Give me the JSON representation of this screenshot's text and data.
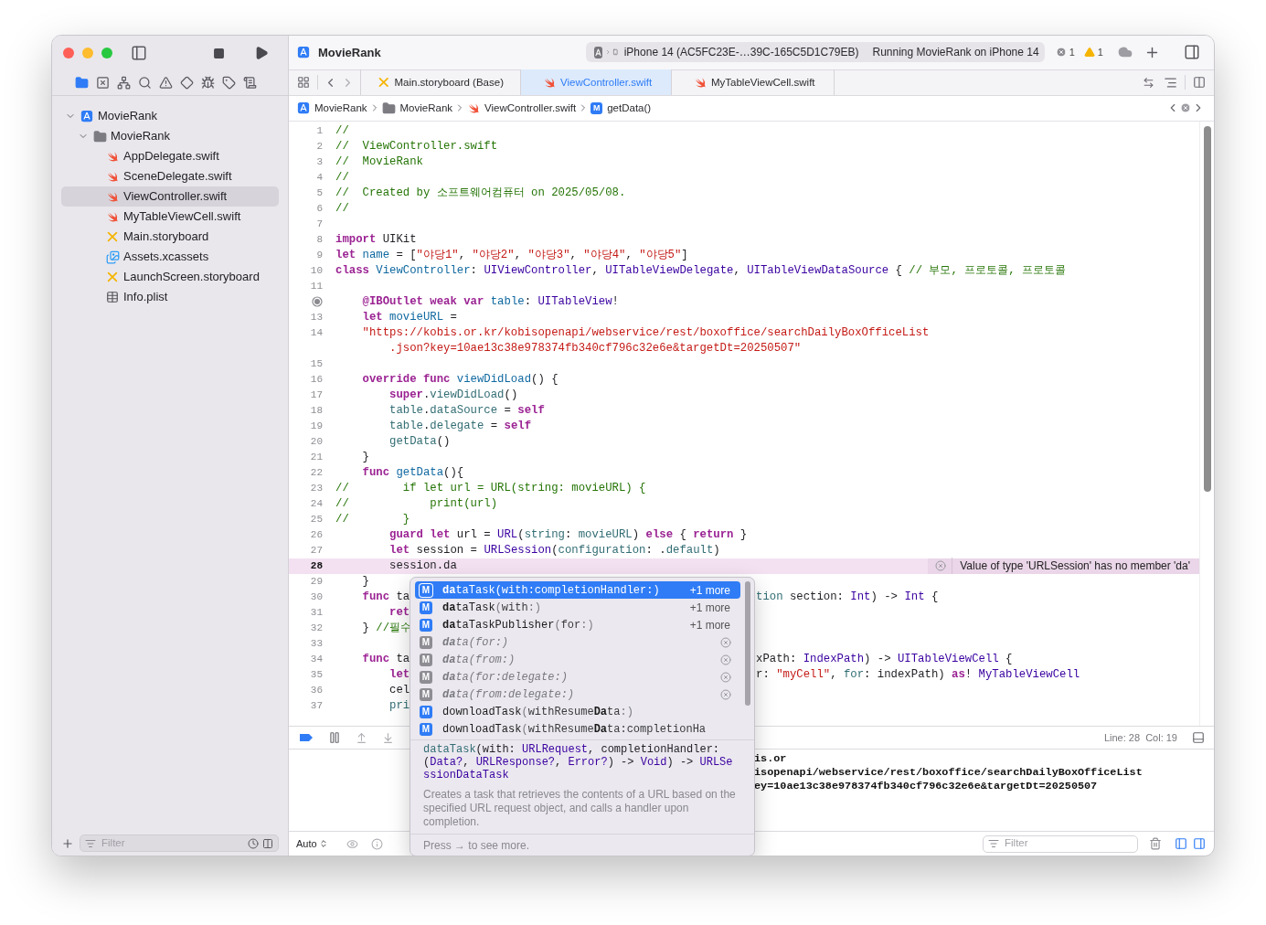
{
  "toolbar": {
    "title": "MovieRank",
    "device": "iPhone 14 (AC5FC23E-…39C-165C5D1C79EB)",
    "status": "Running MovieRank on iPhone 14",
    "errors": "1",
    "warnings": "1"
  },
  "sidebar": {
    "nav_tabs": [
      {
        "selected": true
      },
      {
        "selected": false
      },
      {
        "selected": false
      },
      {
        "selected": false
      },
      {
        "selected": false
      },
      {
        "selected": false
      },
      {
        "selected": false
      },
      {
        "selected": false
      },
      {
        "selected": false
      }
    ],
    "tree": [
      {
        "label": "MovieRank",
        "kind": "project",
        "expanded": true,
        "selected": false,
        "children": [
          {
            "label": "MovieRank",
            "kind": "folder",
            "expanded": true,
            "selected": false,
            "children": [
              {
                "label": "AppDelegate.swift",
                "kind": "swift",
                "selected": false
              },
              {
                "label": "SceneDelegate.swift",
                "kind": "swift",
                "selected": false
              },
              {
                "label": "ViewController.swift",
                "kind": "swift",
                "selected": true
              },
              {
                "label": "MyTableViewCell.swift",
                "kind": "swift",
                "selected": false
              },
              {
                "label": "Main.storyboard",
                "kind": "storyboard",
                "selected": false
              },
              {
                "label": "Assets.xcassets",
                "kind": "assets",
                "selected": false
              },
              {
                "label": "LaunchScreen.storyboard",
                "kind": "storyboard",
                "selected": false
              },
              {
                "label": "Info.plist",
                "kind": "plist",
                "selected": false
              }
            ]
          }
        ]
      }
    ],
    "filter": {
      "placeholder": "Filter"
    }
  },
  "editor": {
    "tabs": [
      {
        "label": "Main.storyboard (Base)",
        "kind": "storyboard",
        "selected": false
      },
      {
        "label": "ViewController.swift",
        "kind": "swift",
        "selected": true
      },
      {
        "label": "MyTableViewCell.swift",
        "kind": "swift",
        "selected": false
      }
    ],
    "breadcrumb": [
      {
        "label": "MovieRank",
        "kind": "project"
      },
      {
        "label": "MovieRank",
        "kind": "folder"
      },
      {
        "label": "ViewController.swift",
        "kind": "swift"
      },
      {
        "label": "getData()",
        "kind": "method",
        "badge": "M"
      }
    ],
    "lines": [
      {
        "n": "1",
        "current": false,
        "outlet": false,
        "tokens": [
          {
            "kind": "comment",
            "text": "//"
          }
        ]
      },
      {
        "n": "2",
        "current": false,
        "outlet": false,
        "tokens": [
          {
            "kind": "comment",
            "text": "//  ViewController.swift"
          }
        ]
      },
      {
        "n": "3",
        "current": false,
        "outlet": false,
        "tokens": [
          {
            "kind": "comment",
            "text": "//  MovieRank"
          }
        ]
      },
      {
        "n": "4",
        "current": false,
        "outlet": false,
        "tokens": [
          {
            "kind": "comment",
            "text": "//"
          }
        ]
      },
      {
        "n": "5",
        "current": false,
        "outlet": false,
        "tokens": [
          {
            "kind": "comment",
            "text": "//  Created by 소프트웨어컴퓨터 on 2025/05/08."
          }
        ]
      },
      {
        "n": "6",
        "current": false,
        "outlet": false,
        "tokens": [
          {
            "kind": "comment",
            "text": "//"
          }
        ]
      },
      {
        "n": "7",
        "current": false,
        "outlet": false
      },
      {
        "n": "8",
        "current": false,
        "outlet": false,
        "tokens": [
          {
            "kind": "keyword",
            "text": "import"
          },
          {
            "kind": "plain",
            "text": " UIKit"
          }
        ]
      },
      {
        "n": "9",
        "current": false,
        "outlet": false,
        "tokens": [
          {
            "kind": "keyword",
            "text": "let"
          },
          {
            "kind": "decl",
            "text": " name"
          },
          {
            "kind": "plain",
            "text": " = ["
          },
          {
            "kind": "string",
            "text": "\"야당1\""
          },
          {
            "kind": "plain",
            "text": ", "
          },
          {
            "kind": "string",
            "text": "\"야당2\""
          },
          {
            "kind": "plain",
            "text": ", "
          },
          {
            "kind": "string",
            "text": "\"야당3\""
          },
          {
            "kind": "plain",
            "text": ", "
          },
          {
            "kind": "string",
            "text": "\"야당4\""
          },
          {
            "kind": "plain",
            "text": ", "
          },
          {
            "kind": "string",
            "text": "\"야당5\""
          },
          {
            "kind": "plain",
            "text": "]"
          }
        ]
      },
      {
        "n": "10",
        "current": false,
        "outlet": false,
        "tokens": [
          {
            "kind": "keyword",
            "text": "class"
          },
          {
            "kind": "decl",
            "text": " ViewController"
          },
          {
            "kind": "plain",
            "text": ": "
          },
          {
            "kind": "type",
            "text": "UIViewController"
          },
          {
            "kind": "plain",
            "text": ", "
          },
          {
            "kind": "type",
            "text": "UITableViewDelegate"
          },
          {
            "kind": "plain",
            "text": ", "
          },
          {
            "kind": "type",
            "text": "UITableViewDataSource"
          },
          {
            "kind": "plain",
            "text": " { "
          },
          {
            "kind": "comment",
            "text": "// 부모, 프로토콜, 프로토콜"
          }
        ]
      },
      {
        "n": "11",
        "current": false,
        "outlet": false
      },
      {
        "current": false,
        "outlet": true,
        "tokens": [
          {
            "kind": "keyword",
            "text": "    @IBOutlet weak var"
          },
          {
            "kind": "decl",
            "text": " table"
          },
          {
            "kind": "plain",
            "text": ": "
          },
          {
            "kind": "type",
            "text": "UITableView"
          },
          {
            "kind": "plain",
            "text": "!"
          }
        ]
      },
      {
        "n": "13",
        "current": false,
        "outlet": false,
        "tokens": [
          {
            "kind": "keyword",
            "text": "    let"
          },
          {
            "kind": "decl",
            "text": " movieURL"
          },
          {
            "kind": "plain",
            "text": " ="
          }
        ]
      },
      {
        "n": "14",
        "current": false,
        "outlet": false,
        "tokens": [
          {
            "kind": "string",
            "text": "    \"https://kobis.or.kr/kobisopenapi/webservice/rest/boxoffice/searchDailyBoxOfficeList"
          }
        ],
        "cont": [
          {
            "kind": "string",
            "text": "        .json?key=10ae13c38e978374fb340cf796c32e6e&targetDt=20250507\""
          }
        ]
      },
      {
        "n": "15",
        "current": false,
        "outlet": false
      },
      {
        "n": "16",
        "current": false,
        "outlet": false,
        "tokens": [
          {
            "kind": "keyword",
            "text": "    override func"
          },
          {
            "kind": "decl",
            "text": " viewDidLoad"
          },
          {
            "kind": "plain",
            "text": "() {"
          }
        ]
      },
      {
        "n": "17",
        "current": false,
        "outlet": false,
        "tokens": [
          {
            "kind": "keyword",
            "text": "        super"
          },
          {
            "kind": "plain",
            "text": "."
          },
          {
            "kind": "member",
            "text": "viewDidLoad"
          },
          {
            "kind": "plain",
            "text": "()"
          }
        ]
      },
      {
        "n": "18",
        "current": false,
        "outlet": false,
        "tokens": [
          {
            "kind": "member",
            "text": "        table"
          },
          {
            "kind": "plain",
            "text": "."
          },
          {
            "kind": "member",
            "text": "dataSource"
          },
          {
            "kind": "plain",
            "text": " = "
          },
          {
            "kind": "keyword",
            "text": "self"
          }
        ]
      },
      {
        "n": "19",
        "current": false,
        "outlet": false,
        "tokens": [
          {
            "kind": "member",
            "text": "        table"
          },
          {
            "kind": "plain",
            "text": "."
          },
          {
            "kind": "member",
            "text": "delegate"
          },
          {
            "kind": "plain",
            "text": " = "
          },
          {
            "kind": "keyword",
            "text": "self"
          }
        ]
      },
      {
        "n": "20",
        "current": false,
        "outlet": false,
        "tokens": [
          {
            "kind": "member",
            "text": "        getData"
          },
          {
            "kind": "plain",
            "text": "()"
          }
        ]
      },
      {
        "n": "21",
        "current": false,
        "outlet": false,
        "tokens": [
          {
            "kind": "plain",
            "text": "    }"
          }
        ]
      },
      {
        "n": "22",
        "current": false,
        "outlet": false,
        "tokens": [
          {
            "kind": "keyword",
            "text": "    func"
          },
          {
            "kind": "decl",
            "text": " getData"
          },
          {
            "kind": "plain",
            "text": "(){"
          }
        ]
      },
      {
        "n": "23",
        "current": false,
        "outlet": false,
        "tokens": [
          {
            "kind": "comment",
            "text": "//        if let url = URL(string: movieURL) {"
          }
        ]
      },
      {
        "n": "24",
        "current": false,
        "outlet": false,
        "tokens": [
          {
            "kind": "comment",
            "text": "//            print(url)"
          }
        ]
      },
      {
        "n": "25",
        "current": false,
        "outlet": false,
        "tokens": [
          {
            "kind": "comment",
            "text": "//        }"
          }
        ]
      },
      {
        "n": "26",
        "current": false,
        "outlet": false,
        "tokens": [
          {
            "kind": "keyword",
            "text": "        guard let"
          },
          {
            "kind": "plain",
            "text": " url = "
          },
          {
            "kind": "type",
            "text": "URL"
          },
          {
            "kind": "plain",
            "text": "("
          },
          {
            "kind": "member",
            "text": "string"
          },
          {
            "kind": "plain",
            "text": ": "
          },
          {
            "kind": "member",
            "text": "movieURL"
          },
          {
            "kind": "plain",
            "text": ") "
          },
          {
            "kind": "keyword",
            "text": "else"
          },
          {
            "kind": "plain",
            "text": " { "
          },
          {
            "kind": "keyword",
            "text": "return"
          },
          {
            "kind": "plain",
            "text": " }"
          }
        ]
      },
      {
        "n": "27",
        "current": false,
        "outlet": false,
        "tokens": [
          {
            "kind": "keyword",
            "text": "        let"
          },
          {
            "kind": "plain",
            "text": " session = "
          },
          {
            "kind": "type",
            "text": "URLSession"
          },
          {
            "kind": "plain",
            "text": "("
          },
          {
            "kind": "member",
            "text": "configuration"
          },
          {
            "kind": "plain",
            "text": ": ."
          },
          {
            "kind": "member",
            "text": "default"
          },
          {
            "kind": "plain",
            "text": ")"
          }
        ]
      },
      {
        "n": "28",
        "current": true,
        "outlet": false,
        "tokens": [
          {
            "kind": "plain",
            "text": "        session.da"
          }
        ],
        "error": "Value of type 'URLSession' has no member 'da'"
      },
      {
        "n": "29",
        "current": false,
        "outlet": false,
        "tokens": [
          {
            "kind": "plain",
            "text": "    }"
          }
        ]
      },
      {
        "n": "30",
        "current": false,
        "outlet": false,
        "tokens": [
          {
            "kind": "keyword",
            "text": "    func"
          },
          {
            "kind": "plain",
            "text": " ta"
          }
        ],
        "right": [
          {
            "kind": "member",
            "text": "tion"
          },
          {
            "kind": "plain",
            "text": " section: "
          },
          {
            "kind": "type",
            "text": "Int"
          },
          {
            "kind": "plain",
            "text": ") -> "
          },
          {
            "kind": "type",
            "text": "Int"
          },
          {
            "kind": "plain",
            "text": " {"
          }
        ]
      },
      {
        "n": "31",
        "current": false,
        "outlet": false,
        "tokens": [
          {
            "kind": "keyword",
            "text": "        ret"
          }
        ]
      },
      {
        "n": "32",
        "current": false,
        "outlet": false,
        "tokens": [
          {
            "kind": "plain",
            "text": "    } "
          },
          {
            "kind": "comment",
            "text": "//필수"
          }
        ]
      },
      {
        "n": "33",
        "current": false,
        "outlet": false
      },
      {
        "n": "34",
        "current": false,
        "outlet": false,
        "tokens": [
          {
            "kind": "keyword",
            "text": "    func"
          },
          {
            "kind": "plain",
            "text": " ta"
          }
        ],
        "right": [
          {
            "kind": "plain",
            "text": "xPath: "
          },
          {
            "kind": "type",
            "text": "IndexPath"
          },
          {
            "kind": "plain",
            "text": ") -> "
          },
          {
            "kind": "type",
            "text": "UITableViewCell"
          },
          {
            "kind": "plain",
            "text": " {"
          }
        ]
      },
      {
        "n": "35",
        "current": false,
        "outlet": false,
        "tokens": [
          {
            "kind": "keyword",
            "text": "        let"
          }
        ],
        "right": [
          {
            "kind": "plain",
            "text": "r: "
          },
          {
            "kind": "string",
            "text": "\"myCell\""
          },
          {
            "kind": "plain",
            "text": ", "
          },
          {
            "kind": "member",
            "text": "for"
          },
          {
            "kind": "plain",
            "text": ": indexPath) "
          },
          {
            "kind": "keyword",
            "text": "as"
          },
          {
            "kind": "plain",
            "text": "! "
          },
          {
            "kind": "type",
            "text": "MyTableViewCell"
          }
        ]
      },
      {
        "n": "36",
        "current": false,
        "outlet": false,
        "tokens": [
          {
            "kind": "plain",
            "text": "        cel"
          }
        ]
      },
      {
        "n": "37",
        "current": false,
        "outlet": false,
        "tokens": [
          {
            "kind": "member",
            "text": "        pri"
          }
        ]
      }
    ]
  },
  "completion": {
    "items": [
      {
        "badge": "M",
        "selected": true,
        "disabled": false,
        "more": "+1 more",
        "parts": [
          {
            "kind": "match",
            "text": "da"
          },
          {
            "kind": "name",
            "text": "taTask"
          },
          {
            "kind": "punct",
            "text": "("
          },
          {
            "kind": "label",
            "text": "with:completionHandler:"
          },
          {
            "kind": "punct",
            "text": ")"
          }
        ]
      },
      {
        "badge": "M",
        "selected": false,
        "disabled": false,
        "more": "+1 more",
        "parts": [
          {
            "kind": "match",
            "text": "da"
          },
          {
            "kind": "name",
            "text": "taTask"
          },
          {
            "kind": "punct",
            "text": "("
          },
          {
            "kind": "label",
            "text": "with"
          },
          {
            "kind": "punct",
            "text": ":)"
          }
        ]
      },
      {
        "badge": "M",
        "selected": false,
        "disabled": false,
        "more": "+1 more",
        "parts": [
          {
            "kind": "match",
            "text": "da"
          },
          {
            "kind": "name",
            "text": "taTaskPublisher"
          },
          {
            "kind": "punct",
            "text": "("
          },
          {
            "kind": "label",
            "text": "for"
          },
          {
            "kind": "punct",
            "text": ":)"
          }
        ]
      },
      {
        "badge": "M",
        "selected": false,
        "disabled": true,
        "parts": [
          {
            "kind": "match",
            "text": "da"
          },
          {
            "kind": "name",
            "text": "ta"
          },
          {
            "kind": "punct",
            "text": "("
          },
          {
            "kind": "label",
            "text": "for"
          },
          {
            "kind": "punct",
            "text": ":)"
          }
        ]
      },
      {
        "badge": "M",
        "selected": false,
        "disabled": true,
        "parts": [
          {
            "kind": "match",
            "text": "da"
          },
          {
            "kind": "name",
            "text": "ta"
          },
          {
            "kind": "punct",
            "text": "("
          },
          {
            "kind": "label",
            "text": "from"
          },
          {
            "kind": "punct",
            "text": ":)"
          }
        ]
      },
      {
        "badge": "M",
        "selected": false,
        "disabled": true,
        "parts": [
          {
            "kind": "match",
            "text": "da"
          },
          {
            "kind": "name",
            "text": "ta"
          },
          {
            "kind": "punct",
            "text": "("
          },
          {
            "kind": "label",
            "text": "for"
          },
          {
            "kind": "punct",
            "text": ":"
          },
          {
            "kind": "italic",
            "text": "delegate"
          },
          {
            "kind": "punct",
            "text": ":)"
          }
        ]
      },
      {
        "badge": "M",
        "selected": false,
        "disabled": true,
        "parts": [
          {
            "kind": "match",
            "text": "da"
          },
          {
            "kind": "name",
            "text": "ta"
          },
          {
            "kind": "punct",
            "text": "("
          },
          {
            "kind": "label",
            "text": "from"
          },
          {
            "kind": "punct",
            "text": ":"
          },
          {
            "kind": "italic",
            "text": "delegate"
          },
          {
            "kind": "punct",
            "text": ":)"
          }
        ]
      },
      {
        "badge": "M",
        "selected": false,
        "disabled": false,
        "parts": [
          {
            "kind": "name",
            "text": "downloadTask"
          },
          {
            "kind": "punct",
            "text": "("
          },
          {
            "kind": "label",
            "text": "withResume"
          },
          {
            "kind": "match",
            "text": "Da"
          },
          {
            "kind": "label",
            "text": "ta"
          },
          {
            "kind": "punct",
            "text": ":)"
          }
        ]
      },
      {
        "badge": "M",
        "selected": false,
        "disabled": false,
        "parts": [
          {
            "kind": "name",
            "text": "downloadTask"
          },
          {
            "kind": "punct",
            "text": "("
          },
          {
            "kind": "label",
            "text": "withResume"
          },
          {
            "kind": "match",
            "text": "Da"
          },
          {
            "kind": "label",
            "text": "ta:completionHa"
          }
        ]
      }
    ],
    "signature": [
      {
        "kind": "member",
        "text": "dataTask"
      },
      {
        "kind": "plain",
        "text": "(with: "
      },
      {
        "kind": "type",
        "text": "URLRequest"
      },
      {
        "kind": "plain",
        "text": ", completionHandler: ("
      },
      {
        "kind": "type",
        "text": "Data?"
      },
      {
        "kind": "plain",
        "text": ", "
      },
      {
        "kind": "type",
        "text": "URLResponse?"
      },
      {
        "kind": "plain",
        "text": ", "
      },
      {
        "kind": "type",
        "text": "Error?"
      },
      {
        "kind": "plain",
        "text": ") -> "
      },
      {
        "kind": "type",
        "text": "Void"
      },
      {
        "kind": "plain",
        "text": ") -> "
      },
      {
        "kind": "type",
        "text": "URLSessionDataTask"
      }
    ],
    "description": "Creates a task that retrieves the contents of a URL based on the specified URL request object, and calls a handler upon completion.",
    "footer": "Press → to see more."
  },
  "debug_bar": {
    "position": "Line: 28  Col: 19"
  },
  "console": {
    "lines": [
      "is.or",
      "isopenapi/webservice/rest/boxoffice/searchDailyBoxOfficeList",
      "ey=10ae13c38e978374fb340cf796c32e6e&targetDt=20250507"
    ],
    "scope": "Auto",
    "filter": {
      "placeholder": "Filter"
    }
  }
}
